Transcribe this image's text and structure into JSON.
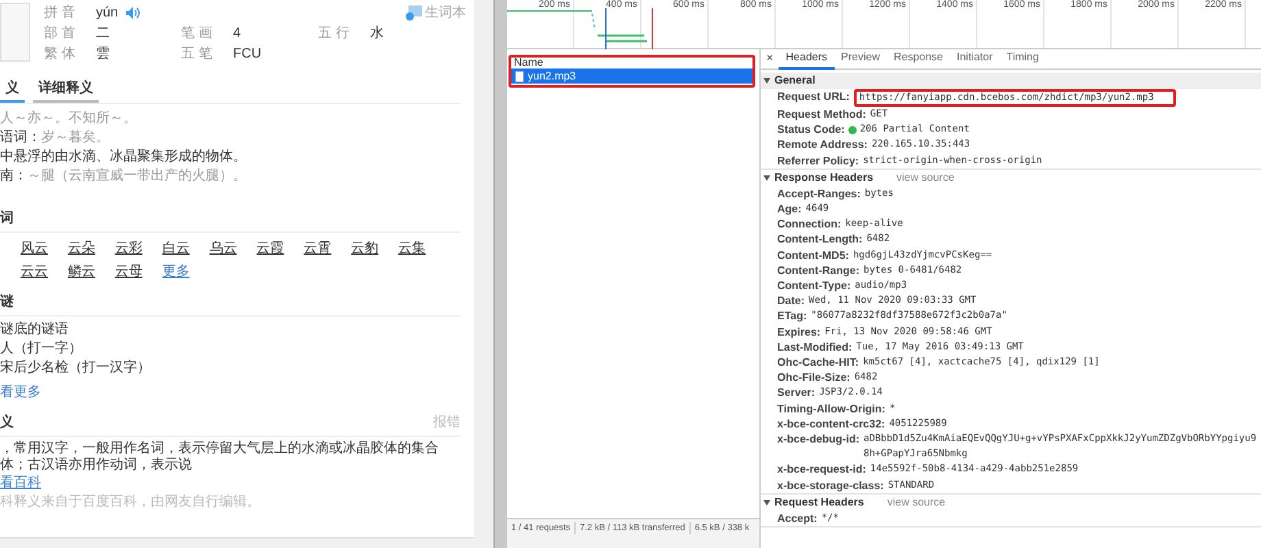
{
  "dictionary": {
    "pinyin_label": "拼音",
    "pinyin": "yún",
    "wordbook": "生词本",
    "info_rows": [
      [
        {
          "label": "部首",
          "value": "二"
        },
        {
          "label": "笔画",
          "value": "4"
        },
        {
          "label": "五行",
          "value": "水"
        }
      ],
      [
        {
          "label": "繁体",
          "value": "雲"
        },
        {
          "label": "五笔",
          "value": "FCU"
        }
      ]
    ],
    "tabs": [
      {
        "label": "义",
        "selected": true
      },
      {
        "label": "详细释义",
        "selected": false
      }
    ],
    "definitions": [
      {
        "text": "人～亦～。不知所～。"
      },
      {
        "term": "语词：",
        "text": "岁～暮矣。"
      },
      {
        "term": "中悬浮的由水滴、冰晶聚集形成的物体。"
      },
      {
        "term": "南：",
        "text": "～腿（云南宣威一带出产的火腿）。"
      }
    ],
    "words_heading": "词",
    "words": [
      "风云",
      "云朵",
      "云彩",
      "白云",
      "乌云",
      "云霞",
      "云霄",
      "云豹",
      "云集",
      "云云",
      "鳞云",
      "云母"
    ],
    "words_more": "更多",
    "riddles_heading": "谜",
    "riddles": [
      "谜底的谜语",
      "人（打一字）",
      "宋后少名检（打一汉字）"
    ],
    "riddles_more": "看更多",
    "encyclopedia_heading": "义",
    "report": "报错",
    "encyclopedia_text": "，常用汉字，一般用作名词，表示停留大气层上的水滴或冰晶胶体的集合体；古汉语亦用作动词，表示说",
    "encyclopedia_link": "看百科",
    "encyclopedia_note": "科释义来自于百度百科，由网友自行编辑。"
  },
  "devtools": {
    "ticks": [
      "200 ms",
      "400 ms",
      "600 ms",
      "800 ms",
      "1000 ms",
      "1200 ms",
      "1400 ms",
      "1600 ms",
      "1800 ms",
      "2000 ms",
      "2200 ms"
    ],
    "requests": {
      "column": "Name",
      "highlighted": true,
      "rows": [
        {
          "name": "yun2.mp3",
          "selected": true
        }
      ]
    },
    "status": [
      "1 / 41 requests",
      "7.2 kB / 113 kB transferred",
      "6.5 kB / 338 k"
    ],
    "close": "×",
    "tabs": [
      {
        "label": "Headers",
        "selected": true
      },
      {
        "label": "Preview",
        "selected": false
      },
      {
        "label": "Response",
        "selected": false
      },
      {
        "label": "Initiator",
        "selected": false
      },
      {
        "label": "Timing",
        "selected": false
      }
    ],
    "sections": [
      {
        "title": "General",
        "expanded": true,
        "rows": [
          {
            "name": "Request URL:",
            "value": "https://fanyiapp.cdn.bcebos.com/zhdict/mp3/yun2.mp3",
            "highlighted": true
          },
          {
            "name": "Request Method:",
            "value": "GET"
          },
          {
            "name": "Status Code:",
            "value": "206 Partial Content",
            "color": "#2fb84c"
          },
          {
            "name": "Remote Address:",
            "value": "220.165.10.35:443"
          },
          {
            "name": "Referrer Policy:",
            "value": "strict-origin-when-cross-origin"
          }
        ]
      },
      {
        "title": "Response Headers",
        "link": "view source",
        "expanded": true,
        "rows": [
          {
            "name": "Accept-Ranges:",
            "value": "bytes"
          },
          {
            "name": "Age:",
            "value": "4649"
          },
          {
            "name": "Connection:",
            "value": "keep-alive"
          },
          {
            "name": "Content-Length:",
            "value": "6482"
          },
          {
            "name": "Content-MD5:",
            "value": "hgd6gjL43zdYjmcvPCsKeg=="
          },
          {
            "name": "Content-Range:",
            "value": "bytes 0-6481/6482"
          },
          {
            "name": "Content-Type:",
            "value": "audio/mp3"
          },
          {
            "name": "Date:",
            "value": "Wed, 11 Nov 2020 09:03:33 GMT"
          },
          {
            "name": "ETag:",
            "value": "\"86077a8232f8df37588e672f3c2b0a7a\""
          },
          {
            "name": "Expires:",
            "value": "Fri, 13 Nov 2020 09:58:46 GMT"
          },
          {
            "name": "Last-Modified:",
            "value": "Tue, 17 May 2016 03:49:13 GMT"
          },
          {
            "name": "Ohc-Cache-HIT:",
            "value": "km5ct67 [4], xactcache75 [4], qdix129 [1]"
          },
          {
            "name": "Ohc-File-Size:",
            "value": "6482"
          },
          {
            "name": "Server:",
            "value": "JSP3/2.0.14"
          },
          {
            "name": "Timing-Allow-Origin:",
            "value": "*"
          },
          {
            "name": "x-bce-content-crc32:",
            "value": "4051225989"
          },
          {
            "name": "x-bce-debug-id:",
            "value": "aDBbbD1d5Zu4KmAiaEQEvQQgYJU+g+vYPsPXAFxCppXkkJ2yYumZDZgVbORbYYpgiyu98h+GPapYJra65Nbmkg"
          },
          {
            "name": "x-bce-request-id:",
            "value": "14e5592f-50b8-4134-a429-4abb251e2859"
          },
          {
            "name": "x-bce-storage-class:",
            "value": "STANDARD"
          }
        ]
      },
      {
        "title": "Request Headers",
        "link": "view source",
        "expanded": true,
        "rows": [
          {
            "name": "Accept:",
            "value": "*/*"
          }
        ]
      }
    ]
  }
}
